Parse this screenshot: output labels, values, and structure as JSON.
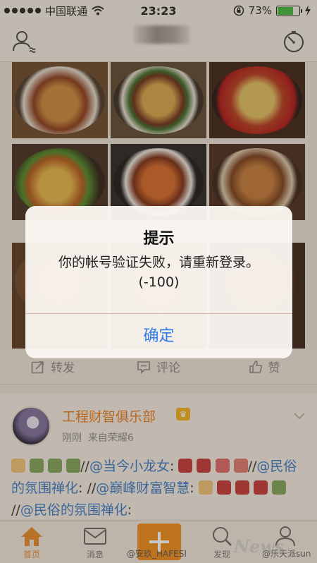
{
  "status_bar": {
    "carrier": "中国联通",
    "time": "23:23",
    "battery_percent": "73%",
    "battery_level": 0.73
  },
  "action_bar": {
    "repost_label": "转发",
    "comment_label": "评论",
    "like_label": "赞"
  },
  "post": {
    "author_name": "工程财智俱乐部",
    "time_label": "刚刚",
    "source_label": "来自荣耀6",
    "text_segments": [
      {
        "text": "//",
        "mention": false
      },
      {
        "text": "@当今小龙女",
        "mention": true
      },
      {
        "text": ":",
        "mention": false
      },
      {
        "text": "//",
        "mention": false
      },
      {
        "text": "@民俗的氛围禅化",
        "mention": true
      },
      {
        "text": ": //",
        "mention": false
      },
      {
        "text": "@巅峰财富智慧",
        "mention": true
      },
      {
        "text": ":",
        "mention": false
      },
      {
        "text": "//",
        "mention": false
      },
      {
        "text": "@民俗的氛围禅化",
        "mention": true
      },
      {
        "text": ":",
        "mention": false
      }
    ]
  },
  "tab_bar": {
    "home_label": "首页",
    "messages_label": "消息",
    "discover_label": "发现",
    "watermark": "@安玖_HAFESI",
    "watermark_logo": "News",
    "watermark_right": "@乐天派sun"
  },
  "alert": {
    "title": "提示",
    "message_line1": "你的帐号验证失败，请重新登录。",
    "message_line2": "(-100)",
    "confirm_label": "确定"
  },
  "colors": {
    "accent_orange": "#f08c1c",
    "link_blue": "#3b7bc8",
    "alert_button": "#2f7be6"
  }
}
